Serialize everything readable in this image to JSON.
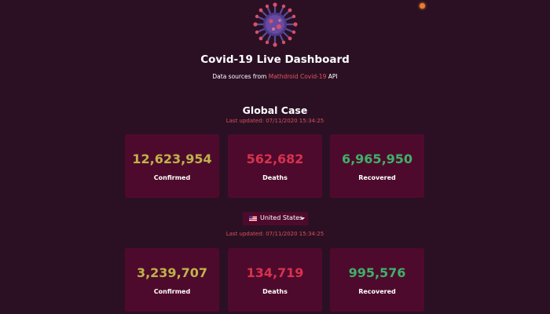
{
  "header": {
    "title": "Covid-19 Live Dashboard",
    "subtitle_prefix": "Data sources from ",
    "subtitle_link": "Mathdroid Covid-19",
    "subtitle_suffix": " API"
  },
  "global": {
    "title": "Global Case",
    "updated": "Last updated: 07/11/2020 15:34:25",
    "confirmed": "12,623,954",
    "confirmed_label": "Confirmed",
    "deaths": "562,682",
    "deaths_label": "Deaths",
    "recovered": "6,965,950",
    "recovered_label": "Recovered"
  },
  "country": {
    "selected": "United States",
    "updated": "Last updated: 07/11/2020 15:34:25",
    "confirmed": "3,239,707",
    "confirmed_label": "Confirmed",
    "deaths": "134,719",
    "deaths_label": "Deaths",
    "recovered": "995,576",
    "recovered_label": "Recovered"
  },
  "icons": {
    "logo": "virus-icon",
    "flag": "us-flag-icon",
    "dropdown": "caret-down-icon",
    "status": "status-dot-icon"
  },
  "colors": {
    "background": "#2b1024",
    "card": "#4e0a2c",
    "confirmed": "#bdb44a",
    "deaths": "#d8324e",
    "recovered": "#3fb06a",
    "accent": "#e0555d"
  }
}
